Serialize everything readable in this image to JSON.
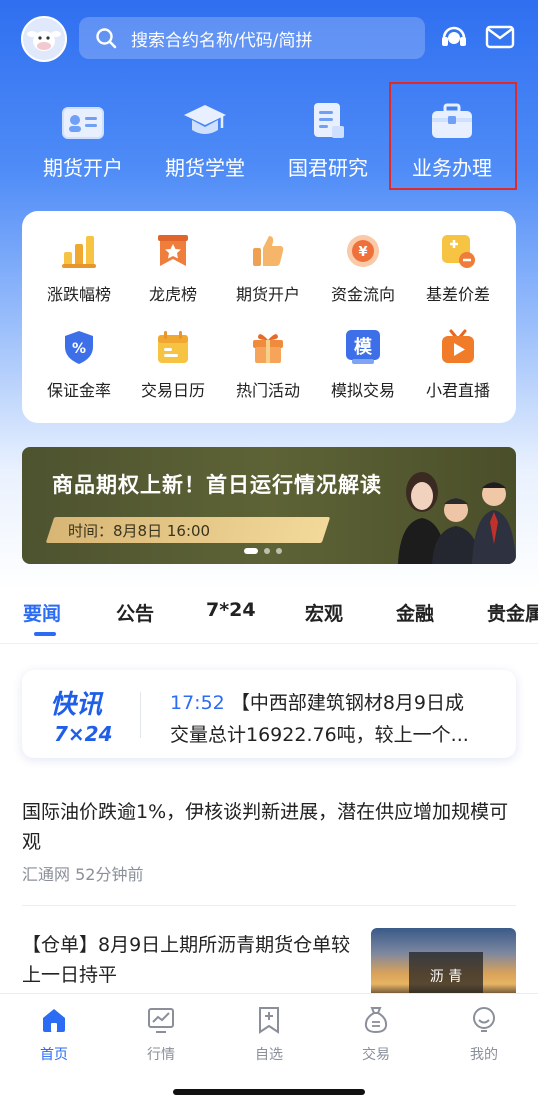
{
  "colors": {
    "brand": "#2c6cf5",
    "highlight_box": "#e02a2a"
  },
  "header": {
    "avatar_icon": "cow-avatar-icon",
    "search_placeholder": "搜索合约名称/代码/简拼",
    "service_icon": "headset-icon",
    "message_icon": "mail-icon"
  },
  "primary_actions": [
    {
      "label": "期货开户",
      "icon": "id-card-icon"
    },
    {
      "label": "期货学堂",
      "icon": "graduation-cap-icon"
    },
    {
      "label": "国君研究",
      "icon": "document-icon"
    },
    {
      "label": "业务办理",
      "icon": "briefcase-icon"
    }
  ],
  "grid": [
    {
      "label": "涨跌幅榜",
      "icon": "bar-chart-icon"
    },
    {
      "label": "龙虎榜",
      "icon": "ribbon-star-icon"
    },
    {
      "label": "期货开户",
      "icon": "thumbs-up-icon"
    },
    {
      "label": "资金流向",
      "icon": "yuan-coin-icon"
    },
    {
      "label": "基差价差",
      "icon": "plus-minus-icon"
    },
    {
      "label": "保证金率",
      "icon": "percent-shield-icon"
    },
    {
      "label": "交易日历",
      "icon": "calendar-icon"
    },
    {
      "label": "热门活动",
      "icon": "gift-icon"
    },
    {
      "label": "模拟交易",
      "icon": "simulate-icon",
      "glyph": "模"
    },
    {
      "label": "小君直播",
      "icon": "tv-play-icon"
    }
  ],
  "banner": {
    "title": "商品期权上新！首日运行情况解读",
    "time": "时间：8月8日   16:00"
  },
  "tabs": [
    "要闻",
    "公告",
    "7*24",
    "宏观",
    "金融",
    "贵金属"
  ],
  "flash": {
    "logo_top": "快讯",
    "logo_bottom": "7×24",
    "time": "17:52",
    "headline": "【中西部建筑钢材8月9日成",
    "line2": "交量总计16922.76吨，较上一个..."
  },
  "news": [
    {
      "title": "国际油价跌逾1%，伊核谈判新进展，潜在供应增加规模可观",
      "meta": "汇通网  52分钟前"
    },
    {
      "title": "【仓单】8月9日上期所沥青期货仓单较上一日持平",
      "image_text": "沥 青"
    }
  ],
  "nav": [
    {
      "label": "首页",
      "icon": "home-icon"
    },
    {
      "label": "行情",
      "icon": "market-chart-icon"
    },
    {
      "label": "自选",
      "icon": "bookmark-plus-icon"
    },
    {
      "label": "交易",
      "icon": "money-bag-icon"
    },
    {
      "label": "我的",
      "icon": "profile-icon"
    }
  ]
}
